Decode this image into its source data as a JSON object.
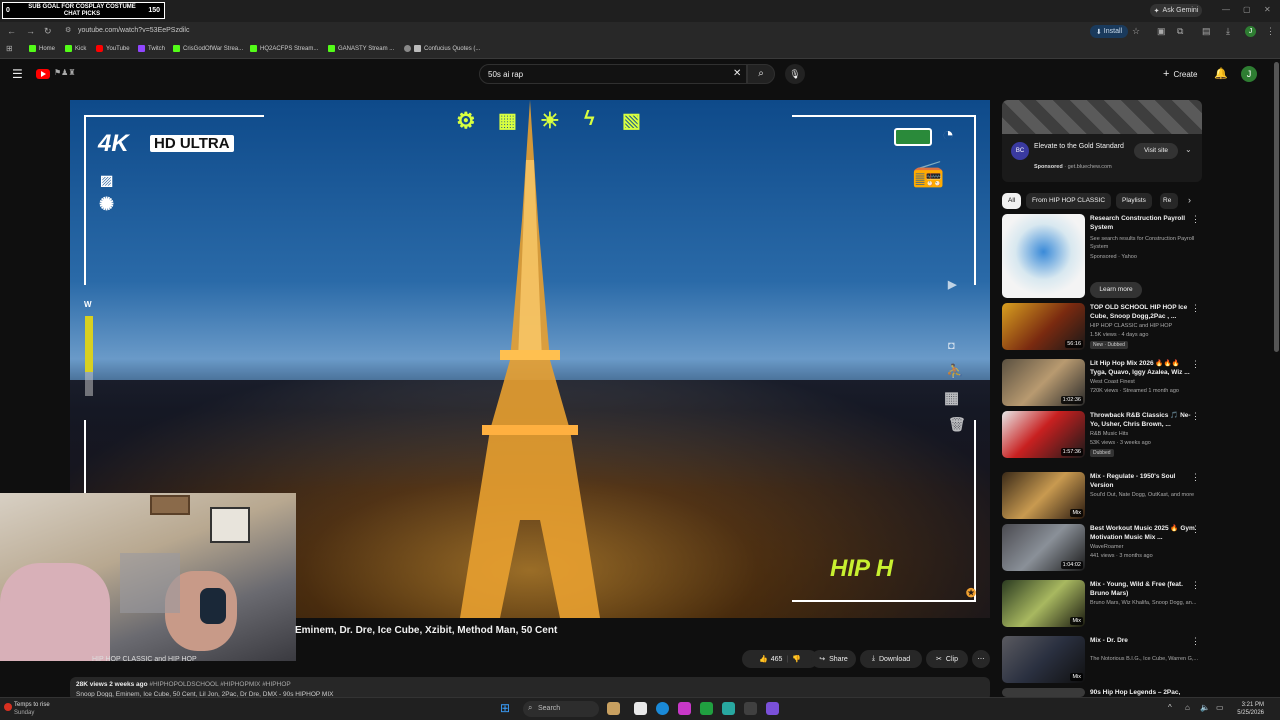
{
  "overlay": {
    "sub_goal_label": "SUB GOAL FOR COSPLAY COSTUME CHAT PICKS",
    "sub_goal_count": "150",
    "sub_goal_current": "0"
  },
  "browser": {
    "url": "youtube.com/watch?v=53EePSzdilc",
    "gemini_label": "Ask Gemini",
    "install_label": "Install",
    "bookmarks": [
      {
        "label": "Home",
        "color": "#53fc18"
      },
      {
        "label": "Kick",
        "color": "#53fc18"
      },
      {
        "label": "YouTube",
        "color": "#ff0000"
      },
      {
        "label": "Twitch",
        "color": "#9146ff"
      },
      {
        "label": "CrisGodOfWar Strea...",
        "color": "#53fc18"
      },
      {
        "label": "HQ2ACFPS Stream...",
        "color": "#53fc18"
      },
      {
        "label": "GANASTY Stream ...",
        "color": "#53fc18"
      },
      {
        "label": "Confucius Quotes (...",
        "color": "#888888"
      }
    ]
  },
  "youtube": {
    "search_query": "50s ai rap",
    "create_label": "Create",
    "avatar_letter": "J"
  },
  "video": {
    "hud_4k": "4K",
    "hud_ultra": "HD ULTRA",
    "hud_w": "W",
    "overlay_text": "HIP H",
    "title": "Eminem, Dr. Dre, Ice Cube, Xzibit, Method Man, 50 Cent",
    "channel": "HIP HOP CLASSIC and HIP HOP",
    "likes": "465",
    "share_label": "Share",
    "download_label": "Download",
    "clip_label": "Clip",
    "views": "28K views",
    "age": "2 weeks ago",
    "tags": "#HIPHOPOLDSCHOOL #HIPHOPMIX #HIPHOP",
    "desc_line": "Snoop Dogg, Eminem, Ice Cube, 50 Cent, Lil Jon, 2Pac, Dr Dre, DMX - 90s HIPHOP MIX"
  },
  "ad": {
    "avatar": "BC",
    "title": "Elevate to the Gold Standard",
    "sponsored": "Sponsored",
    "domain": "get.bluechew.com",
    "visit_label": "Visit site"
  },
  "chips": [
    "All",
    "From HIP HOP CLASSIC",
    "Playlists",
    "Re"
  ],
  "recommendations": [
    {
      "title": "Research Construction Payroll System",
      "channel": "See search results for Construction Payroll System",
      "views": "Sponsored · Yahoo",
      "duration": "",
      "badge": "",
      "cta": "Learn more"
    },
    {
      "title": "TOP OLD SCHOOL HIP HOP Ice Cube, Snoop Dogg,2Pac , ...",
      "channel": "HIP HOP CLASSIC and HIP HOP",
      "views": "1.5K views · 4 days ago",
      "duration": "56:16",
      "badge": "New · Dubbed",
      "cta": ""
    },
    {
      "title": "Lit Hip Hop Mix 2026 🔥🔥🔥 Tyga, Quavo, Iggy Azalea, Wiz ...",
      "channel": "West Coast Finest",
      "views": "720K views · Streamed 1 month ago",
      "duration": "1:02:36",
      "badge": "",
      "cta": ""
    },
    {
      "title": "Throwback R&B Classics 🎵 Ne-Yo, Usher, Chris Brown, ...",
      "channel": "R&B Music Hits",
      "views": "53K views · 3 weeks ago",
      "duration": "1:57:36",
      "badge": "Dubbed",
      "cta": ""
    },
    {
      "title": "Mix - Regulate - 1950's Soul Version",
      "channel": "Soul'd Out, Nate Dogg, OutKast, and more",
      "views": "",
      "duration": "Mix",
      "badge": "",
      "cta": ""
    },
    {
      "title": "Best Workout Music 2025 🔥 Gym Motivation Music Mix ...",
      "channel": "WaveRoamer",
      "views": "441 views · 3 months ago",
      "duration": "1:04:02",
      "badge": "",
      "cta": ""
    },
    {
      "title": "Mix - Young, Wild & Free (feat. Bruno Mars)",
      "channel": "Bruno Mars, Wiz Khalifa, Snoop Dogg, an...",
      "views": "",
      "duration": "Mix",
      "badge": "",
      "cta": ""
    },
    {
      "title": "Mix - Dr. Dre",
      "channel": "The Notorious B.I.G., Ice Cube, Warren G,...",
      "views": "",
      "duration": "Mix",
      "badge": "",
      "cta": ""
    },
    {
      "title": "90s Hip Hop Legends – 2Pac,",
      "channel": "",
      "views": "",
      "duration": "",
      "badge": "",
      "cta": ""
    }
  ],
  "taskbar": {
    "weather_title": "Temps to rise",
    "weather_sub": "Sunday",
    "search_label": "Search",
    "time": "3:21 PM",
    "date": "5/25/2026"
  }
}
